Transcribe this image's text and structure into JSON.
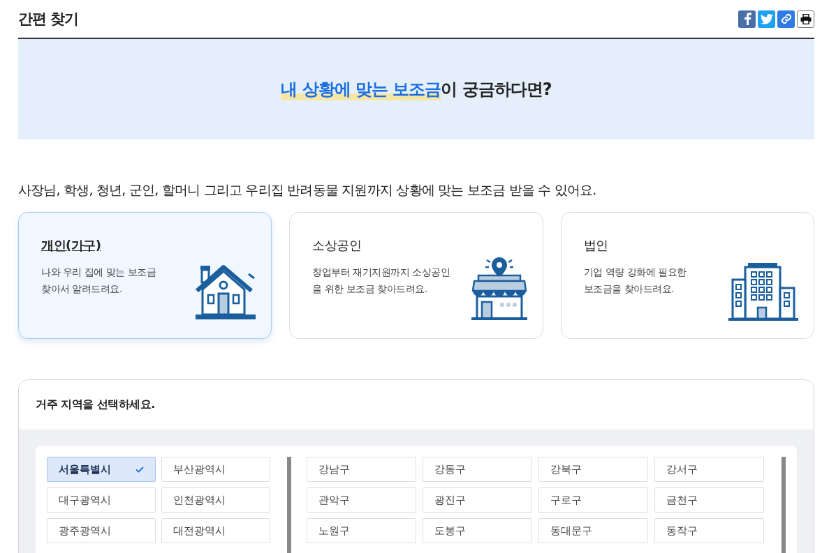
{
  "title": "간편 찾기",
  "share_buttons": [
    {
      "kind": "facebook"
    },
    {
      "kind": "twitter"
    },
    {
      "kind": "link"
    },
    {
      "kind": "print"
    }
  ],
  "banner": {
    "highlight": "내 상황에 맞는 보조금",
    "rest": "이 궁금하다면?"
  },
  "intro": "사장님, 학생, 청년, 군인, 할머니 그리고 우리집 반려동물 지원까지 상황에 맞는 보조금 받을 수 있어요.",
  "categories": [
    {
      "title": "개인(가구)",
      "description": "나와 우리 집에 맞는 보조금\n찾아서 알려드려요.",
      "kind": "house",
      "selected": true
    },
    {
      "title": "소상공인",
      "description": "창업부터 재기지원까지 소상공인\n을 위한 보조금 찾아드려요.",
      "kind": "shop",
      "selected": false
    },
    {
      "title": "법인",
      "description": "기업 역량 강화에 필요한\n보조금을 찾아드려요.",
      "kind": "building",
      "selected": false
    }
  ],
  "region": {
    "prompt": "거주 지역을 선택하세요.",
    "cities": [
      {
        "label": "서울특별시",
        "selected": true
      },
      {
        "label": "부산광역시",
        "selected": false
      },
      {
        "label": "대구광역시",
        "selected": false
      },
      {
        "label": "인천광역시",
        "selected": false
      },
      {
        "label": "광주광역시",
        "selected": false
      },
      {
        "label": "대전광역시",
        "selected": false
      }
    ],
    "districts": [
      {
        "label": "강남구",
        "selected": false
      },
      {
        "label": "강동구",
        "selected": false
      },
      {
        "label": "강북구",
        "selected": false
      },
      {
        "label": "강서구",
        "selected": false
      },
      {
        "label": "관악구",
        "selected": false
      },
      {
        "label": "광진구",
        "selected": false
      },
      {
        "label": "구로구",
        "selected": false
      },
      {
        "label": "금천구",
        "selected": false
      },
      {
        "label": "노원구",
        "selected": false
      },
      {
        "label": "도봉구",
        "selected": false
      },
      {
        "label": "동대문구",
        "selected": false
      },
      {
        "label": "동작구",
        "selected": false
      }
    ]
  }
}
